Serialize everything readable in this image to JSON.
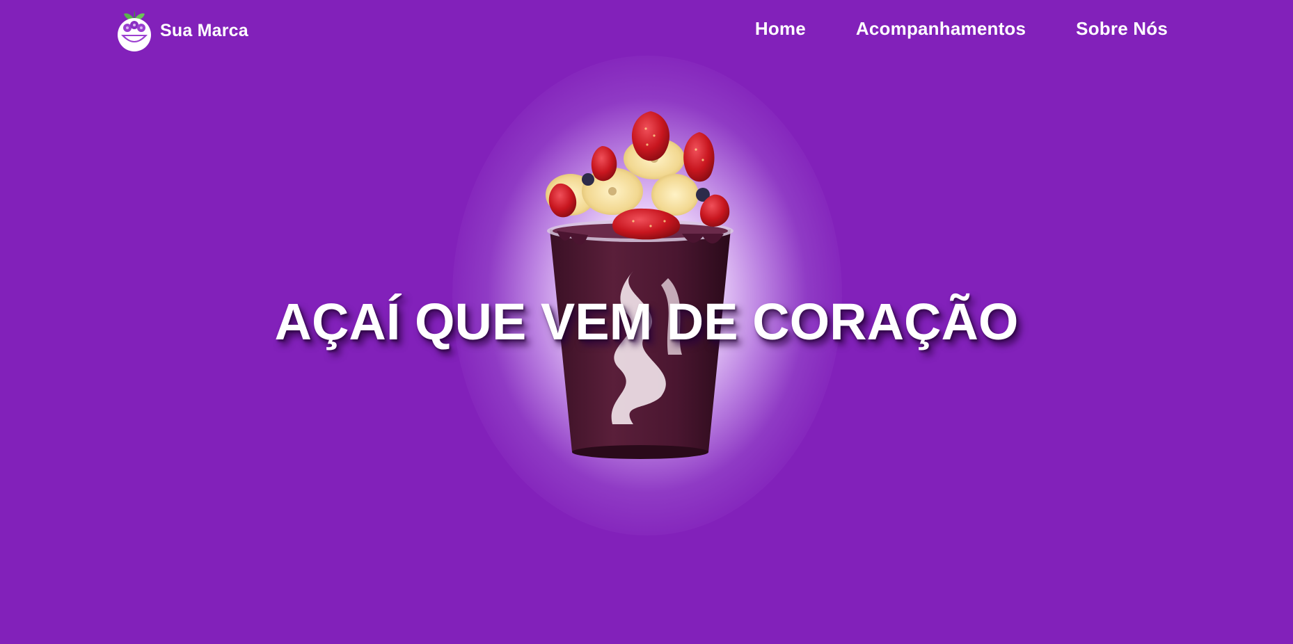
{
  "header": {
    "brand_name": "Sua Marca",
    "logo_icon": "acai-bowl-logo-icon",
    "nav": [
      {
        "label": "Home"
      },
      {
        "label": "Acompanhamentos"
      },
      {
        "label": "Sobre Nós"
      }
    ]
  },
  "hero": {
    "title": "AÇAÍ QUE VEM DE CORAÇÃO",
    "image": "acai-cup-with-strawberries-and-bananas"
  },
  "colors": {
    "background": "#8221ba",
    "text": "#ffffff",
    "logo_accent": "#9b3fd0",
    "leaf": "#5ab54a"
  }
}
